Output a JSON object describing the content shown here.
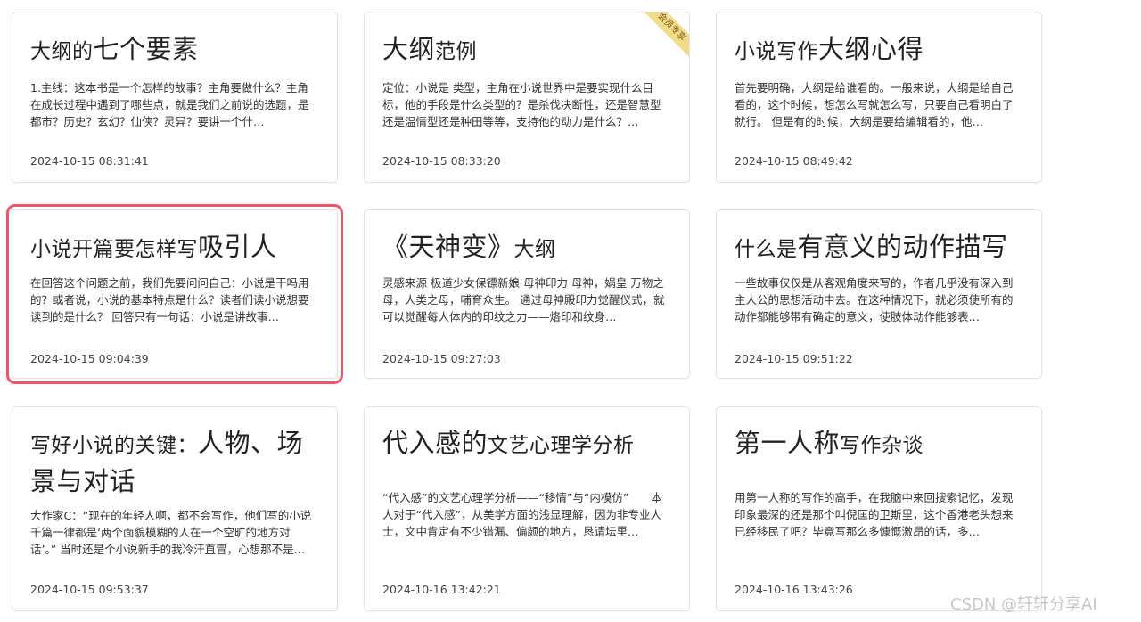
{
  "cards": [
    {
      "title_a": "大纲的",
      "title_b": "七个要素",
      "excerpt": "1.主线：这本书是一个怎样的故事？主角要做什么？主角在成长过程中遇到了哪些点，就是我们之前说的选题，是都市？历史？玄幻？仙侠？灵异？要讲一个什…",
      "date": "2024-10-15 08:31:41"
    },
    {
      "title_a": "大纲",
      "title_b": "范例",
      "vip": "会员专享",
      "excerpt": "定位：小说是 类型，主角在小说世界中是要实现什么目标，他的手段是什么类型的？是杀伐决断性，还是智慧型还是温情型还是种田等等，支持他的动力是什么？…",
      "date": "2024-10-15 08:33:20"
    },
    {
      "title_a": "小说写作",
      "title_b": "大纲心得",
      "excerpt": "首先要明确，大纲是给谁看的。一般来说，大纲是给自己看的，这个时候，想怎么写就怎么写，只要自己看明白了就行。 但是有的时候，大纲是要给编辑看的，他…",
      "date": "2024-10-15 08:49:42"
    },
    {
      "title_a": "小说开篇要怎样写",
      "title_b": "吸引人",
      "excerpt": "在回答这个问题之前，我们先要问问自己：小说是干吗用的？或者说，小说的基本特点是什么？读者们读小说想要读到的是什么？ 回答只有一句话：小说是讲故事…",
      "date": "2024-10-15 09:04:39"
    },
    {
      "title_a": "《天神变》",
      "title_b": "大纲",
      "excerpt": "灵感来源 极道少女保镖新娘 母神印力 母神，娲皇 万物之母，人类之母，哺育众生。 通过母神殿印力觉醒仪式，就可以觉醒每人体内的印纹之力——烙印和纹身…",
      "date": "2024-10-15 09:27:03"
    },
    {
      "title_a": "什么是",
      "title_b": "有意义的动作描写",
      "excerpt": "一些故事仅仅是从客观角度来写的，作者几乎没有深入到主人公的思想活动中去。在这种情况下，就必须使所有的动作都能够带有确定的意义，使肢体动作能够表…",
      "date": "2024-10-15 09:51:22"
    },
    {
      "title_a": "写好小说的关键：",
      "title_b": "人物、场景与对话",
      "excerpt": "大作家C：“现在的年轻人啊，都不会写作，他们写的小说千篇一律都是‘两个面貌模糊的人在一个空旷的地方对话’。” 当时还是个小说新手的我冷汗直冒，心想那不是…",
      "date": "2024-10-15 09:53:37"
    },
    {
      "title_a": "代入感的",
      "title_b": "文艺心理学分析",
      "excerpt": "“代入感”的文艺心理学分析——“移情”与“内模仿”　　本人对于“代入感”，从美学方面的浅显理解，因为非专业人士，文中肯定有不少错漏、偏颇的地方，恳请坛里…",
      "date": "2024-10-16 13:42:21"
    },
    {
      "title_a": "第一人称",
      "title_b": "写作杂谈",
      "excerpt": "用第一人称的写作的高手，在我脑中来回搜索记忆，发现印象最深的还是那个叫倪匡的卫斯里，这个香港老头想来已经移民了吧？毕竟写那么多慷慨激昂的话，多…",
      "date": "2024-10-16 13:43:26"
    }
  ],
  "watermark": "CSDN @轩轩分享AI",
  "colors": {
    "selection_outline": "#f0546a",
    "vip_ribbon": "#f2dc8a"
  }
}
